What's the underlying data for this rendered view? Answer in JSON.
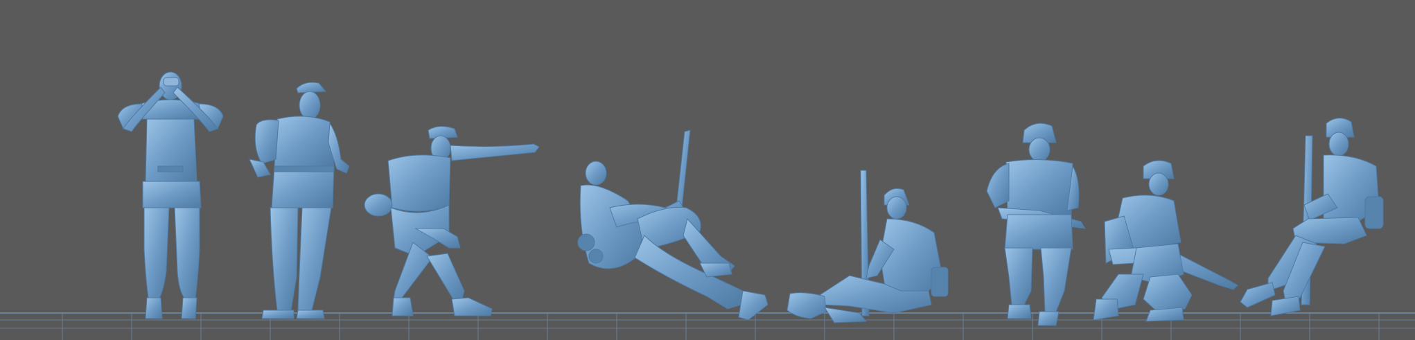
{
  "scene": {
    "background_color": "#5a5a5a",
    "figure_color": "#6d9bc6",
    "figure_shadow_color": "#4e7aa3",
    "figure_highlight_color": "#9cc3e6",
    "grid_color": "#6f8fb0",
    "figures": [
      {
        "id": "figure-binoculars",
        "pose": "standing-binoculars"
      },
      {
        "id": "figure-officer-cap",
        "pose": "standing-hands-at-belt"
      },
      {
        "id": "figure-pointing",
        "pose": "crouching-pointing"
      },
      {
        "id": "figure-reclining-rifle",
        "pose": "reclining-rifle"
      },
      {
        "id": "figure-sitting-rifle",
        "pose": "sitting-rifle"
      },
      {
        "id": "figure-standing-smg",
        "pose": "standing-smg"
      },
      {
        "id": "figure-kneeling-rifle",
        "pose": "kneeling-rifle"
      },
      {
        "id": "figure-seated-mg",
        "pose": "seated-mg"
      }
    ]
  }
}
